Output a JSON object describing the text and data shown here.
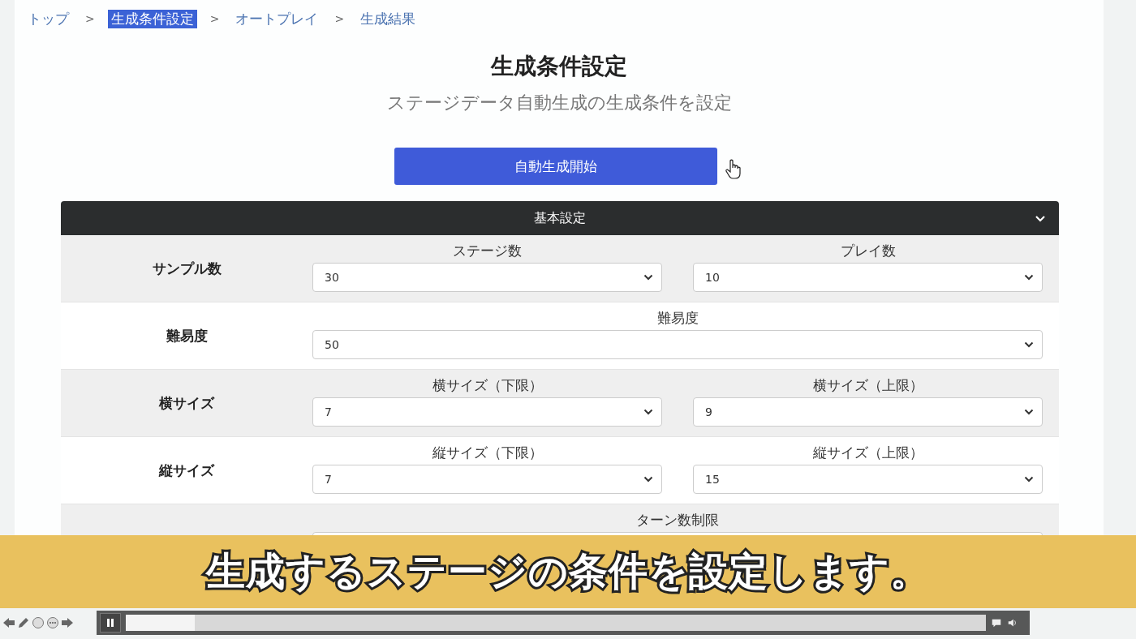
{
  "breadcrumb": [
    {
      "label": "トップ",
      "selected": false
    },
    {
      "label": "生成条件設定",
      "selected": true
    },
    {
      "label": "オートプレイ",
      "selected": false
    },
    {
      "label": "生成結果",
      "selected": false
    }
  ],
  "breadcrumb_separator": ">",
  "title": "生成条件設定",
  "subtitle": "ステージデータ自動生成の生成条件を設定",
  "start_button": "自動生成開始",
  "panel": {
    "title": "基本設定",
    "expanded": true,
    "rows": [
      {
        "label": "サンプル数",
        "fields": [
          {
            "label": "ステージ数",
            "value": "30"
          },
          {
            "label": "プレイ数",
            "value": "10"
          }
        ]
      },
      {
        "label": "難易度",
        "fields": [
          {
            "label": "難易度",
            "value": "50"
          }
        ]
      },
      {
        "label": "横サイズ",
        "fields": [
          {
            "label": "横サイズ（下限）",
            "value": "7"
          },
          {
            "label": "横サイズ（上限）",
            "value": "9"
          }
        ]
      },
      {
        "label": "縦サイズ",
        "fields": [
          {
            "label": "縦サイズ（下限）",
            "value": "7"
          },
          {
            "label": "縦サイズ（上限）",
            "value": "15"
          }
        ]
      },
      {
        "fields": [
          {
            "label": "ターン数制限"
          }
        ]
      }
    ]
  },
  "caption": "生成するステージの条件を設定します。",
  "player": {
    "playing": true,
    "level": 0.08
  }
}
